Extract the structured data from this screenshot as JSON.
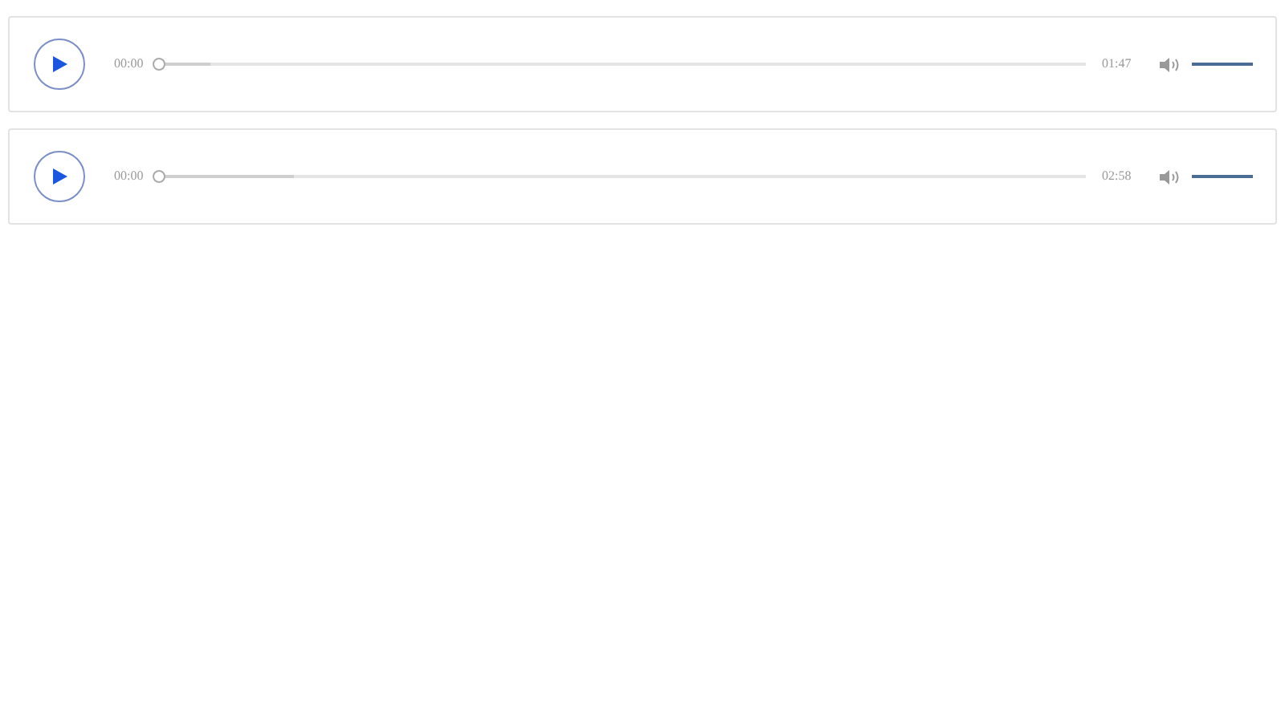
{
  "players": [
    {
      "current_time": "00:00",
      "duration": "01:47",
      "progress": {
        "level": 0
      },
      "buffered": {
        "level": 0.06
      },
      "volume": {
        "level": 1
      }
    },
    {
      "current_time": "00:00",
      "duration": "02:58",
      "progress": {
        "level": 0
      },
      "buffered": {
        "level": 0.15
      },
      "volume": {
        "level": 1
      }
    }
  ]
}
